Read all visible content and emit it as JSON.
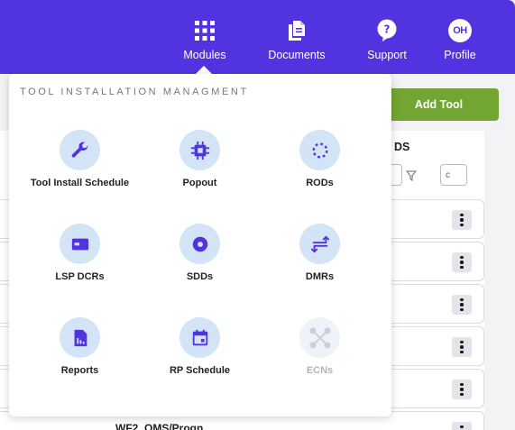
{
  "nav": {
    "modules": "Modules",
    "documents": "Documents",
    "support": "Support",
    "profile": "Profile",
    "avatar_initials": "OH"
  },
  "background": {
    "add_tool": "Add Tool",
    "column_header": "DS",
    "filter_placeholder": "c",
    "row_partial_text": "WF2, OMS/Progn"
  },
  "dropdown": {
    "title": "TOOL INSTALLATION MANAGMENT",
    "items": [
      {
        "label": "Tool Install Schedule",
        "icon": "wrench-icon",
        "enabled": true
      },
      {
        "label": "Popout",
        "icon": "chip-icon",
        "enabled": true
      },
      {
        "label": "RODs",
        "icon": "dotted-circle-icon",
        "enabled": true
      },
      {
        "label": "LSP DCRs",
        "icon": "card-icon",
        "enabled": true
      },
      {
        "label": "SDDs",
        "icon": "target-icon",
        "enabled": true
      },
      {
        "label": "DMRs",
        "icon": "swap-arrows-icon",
        "enabled": true
      },
      {
        "label": "Reports",
        "icon": "report-icon",
        "enabled": true
      },
      {
        "label": "RP Schedule",
        "icon": "calendar-icon",
        "enabled": true
      },
      {
        "label": "ECNs",
        "icon": "network-icon",
        "enabled": false
      }
    ]
  },
  "colors": {
    "primary": "#5133e0",
    "accent_green": "#73a533",
    "icon_bg": "#d3e4f7"
  }
}
